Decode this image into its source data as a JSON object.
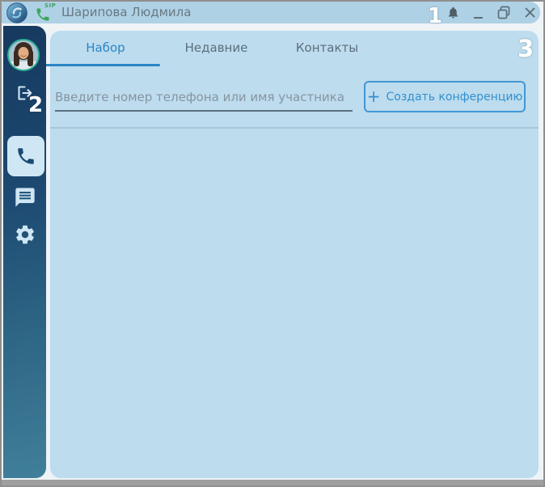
{
  "window": {
    "title": "Шарипова Людмила"
  },
  "titlebar": {
    "sip_label": "SIP"
  },
  "annotations": {
    "n1": "1",
    "n2": "2",
    "n3": "3"
  },
  "tabs": {
    "items": [
      {
        "label": "Набор",
        "active": true
      },
      {
        "label": "Недавние",
        "active": false
      },
      {
        "label": "Контакты",
        "active": false
      }
    ]
  },
  "dialer": {
    "input_value": "",
    "input_placeholder": "Введите номер телефона или имя участника",
    "button_plus": "+",
    "button_label": "Создать конференцию"
  },
  "icons": {
    "logo": "app-swirl-circle",
    "sip_phone": "green-phone-handset",
    "bell": "notifications-bell",
    "minimize": "underscore",
    "restore": "overlapping-windows",
    "close": "x-cross",
    "avatar": "user-photo",
    "exit": "logout-door-arrow",
    "phone": "phone-handset",
    "chat": "speech-bubble-lines",
    "gear": "settings-cog"
  },
  "colors": {
    "accent": "#2b86c5",
    "titlebar_bg": "#aed1e5",
    "panel_bg": "#bddcee",
    "sidebar_top": "#16395f",
    "sidebar_bottom": "#407f9a",
    "sip_green": "#3ca45e",
    "button_border": "#4197d4",
    "avatar_ring": "#2fae96",
    "annotation_text": "#ffffff"
  }
}
